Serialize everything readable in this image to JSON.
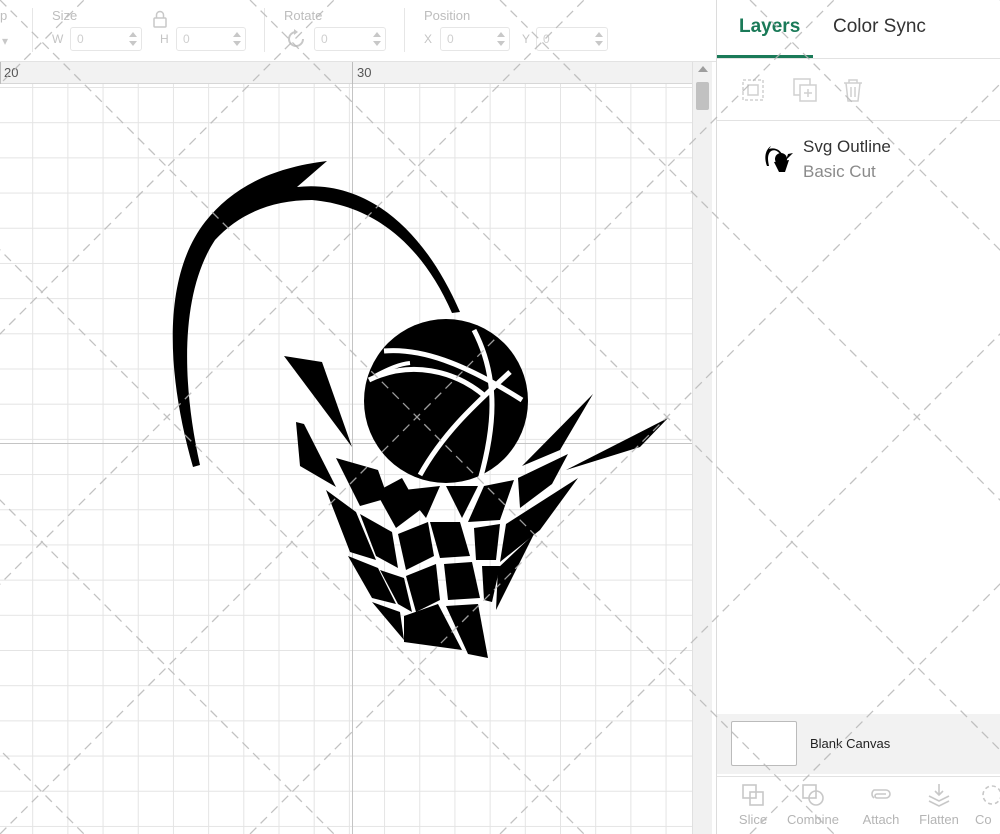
{
  "toolbar": {
    "partial_label": "p",
    "size_label": "Size",
    "w_label": "W",
    "w_value": "0",
    "h_label": "H",
    "h_value": "0",
    "rotate_label": "Rotate",
    "rotate_value": "0",
    "position_label": "Position",
    "x_label": "X",
    "x_value": "0",
    "y_label": "Y",
    "y_value": "0"
  },
  "ruler": {
    "marks": [
      "20",
      "30"
    ]
  },
  "canvas": {
    "design_name": "basketball-hoop-logo",
    "design_color": "#000000"
  },
  "panel": {
    "tabs": [
      {
        "label": "Layers",
        "active": true
      },
      {
        "label": "Color Sync",
        "active": false
      }
    ],
    "actions": [
      "group-icon",
      "duplicate-icon",
      "delete-icon"
    ],
    "layers": [
      {
        "name": "Svg Outline",
        "type": "Basic Cut"
      }
    ],
    "blank_canvas_label": "Blank Canvas",
    "tools": [
      {
        "label": "Slice",
        "icon": "slice-icon"
      },
      {
        "label": "Combine",
        "icon": "combine-icon"
      },
      {
        "label": "Attach",
        "icon": "attach-icon"
      },
      {
        "label": "Flatten",
        "icon": "flatten-icon"
      },
      {
        "label": "Co",
        "icon": "contour-icon"
      }
    ]
  },
  "colors": {
    "accent": "#1a7a58",
    "grid": "#e4e4e4",
    "panel_bg": "#ffffff"
  }
}
